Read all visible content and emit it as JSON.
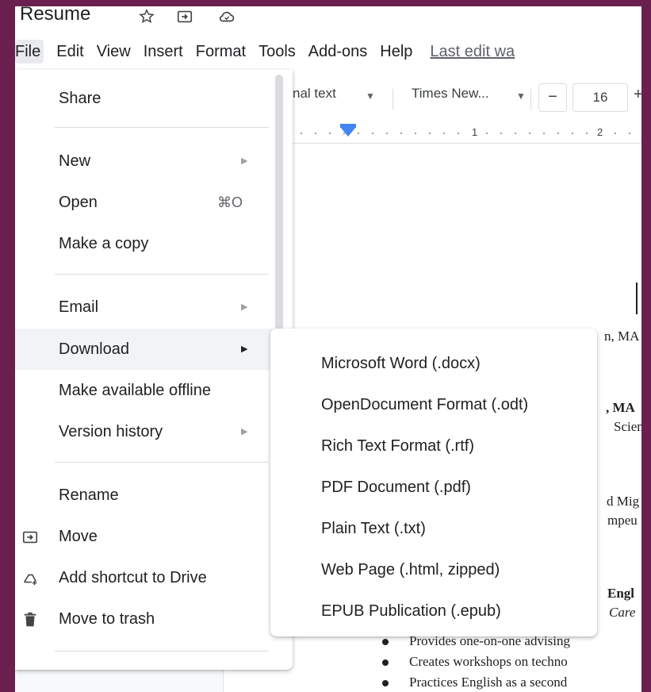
{
  "document": {
    "title": "Resume"
  },
  "menubar": {
    "items": [
      "File",
      "Edit",
      "View",
      "Insert",
      "Format",
      "Tools",
      "Add-ons",
      "Help"
    ],
    "last_edit": "Last edit wa"
  },
  "toolbar": {
    "style_value": "nal text",
    "font_value": "Times New...",
    "font_size": "16",
    "minus": "−",
    "plus": "+"
  },
  "ruler": {
    "labels": [
      "1",
      "2"
    ]
  },
  "file_menu": {
    "items": [
      {
        "label": "Share"
      },
      {
        "label": "New",
        "submenu": true
      },
      {
        "label": "Open",
        "shortcut": "⌘O"
      },
      {
        "label": "Make a copy"
      },
      {
        "label": "Email",
        "submenu": true
      },
      {
        "label": "Download",
        "submenu": true,
        "highlighted": true
      },
      {
        "label": "Make available offline"
      },
      {
        "label": "Version history",
        "submenu": true
      },
      {
        "label": "Rename"
      },
      {
        "label": "Move",
        "icon": "move-folder-icon"
      },
      {
        "label": "Add shortcut to Drive",
        "icon": "add-shortcut-icon"
      },
      {
        "label": "Move to trash",
        "icon": "trash-icon"
      }
    ]
  },
  "download_submenu": {
    "items": [
      "Microsoft Word (.docx)",
      "OpenDocument Format (.odt)",
      "Rich Text Format (.rtf)",
      "PDF Document (.pdf)",
      "Plain Text (.txt)",
      "Web Page (.html, zipped)",
      "EPUB Publication (.epub)"
    ]
  },
  "doc_content": {
    "fragments": [
      "n, MA",
      ", MA",
      "Scien",
      "d Mig",
      "mpeu",
      "Engl",
      "Care"
    ],
    "bullets": [
      "Provides one-on-one advising",
      "Creates workshops on techno",
      "Practices English as a second"
    ]
  },
  "colors": {
    "frame": "#6b1f4e",
    "menu_highlight": "#f1f3f4",
    "ruler_marker": "#4285f4"
  }
}
